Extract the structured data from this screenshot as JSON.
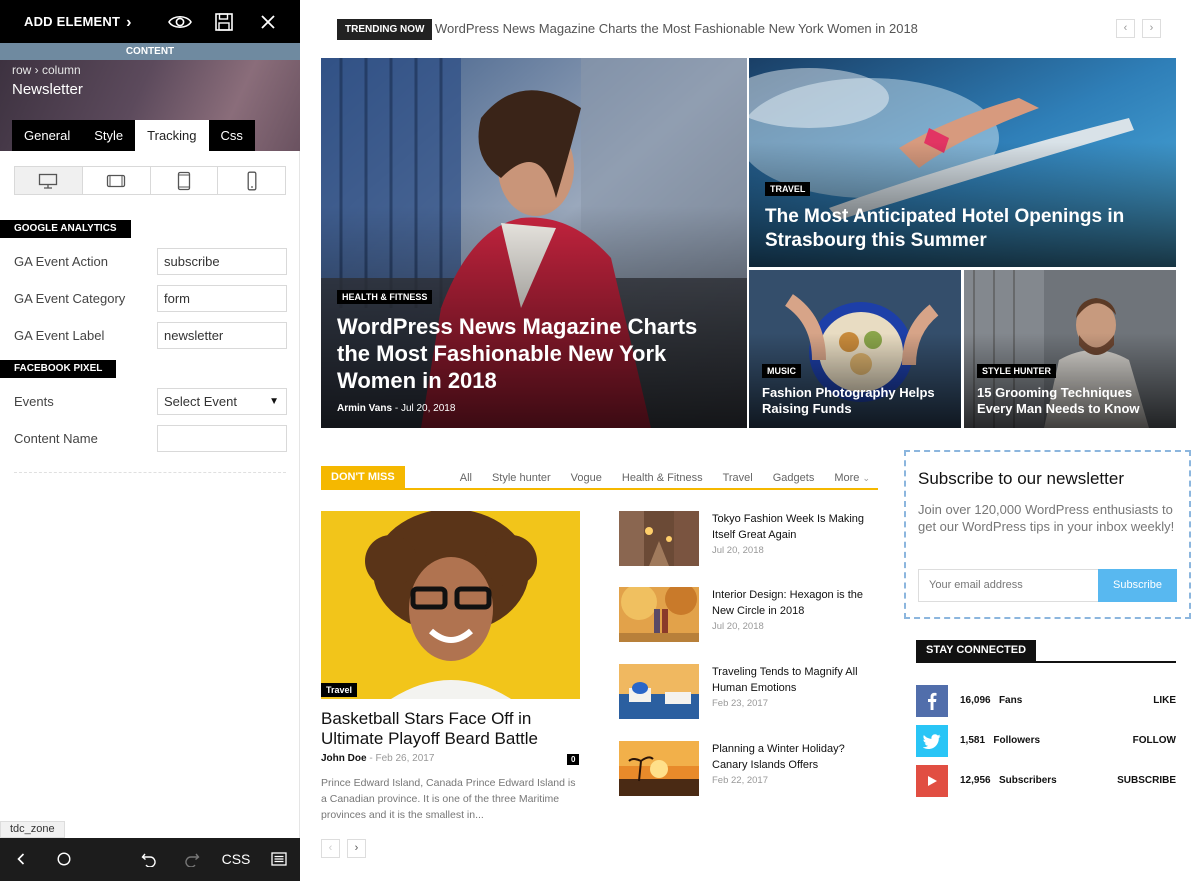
{
  "panel": {
    "add_element": "ADD ELEMENT",
    "content_strip": "CONTENT",
    "breadcrumb": "row › column",
    "element_name": "Newsletter",
    "tabs": [
      {
        "label": "General"
      },
      {
        "label": "Style"
      },
      {
        "label": "Tracking",
        "active": true
      },
      {
        "label": "Css"
      }
    ],
    "ga": {
      "heading": "GOOGLE ANALYTICS",
      "rows": [
        {
          "label": "GA Event Action",
          "value": "subscribe"
        },
        {
          "label": "GA Event Category",
          "value": "form"
        },
        {
          "label": "GA Event Label",
          "value": "newsletter"
        }
      ]
    },
    "fb": {
      "heading": "FACEBOOK PIXEL",
      "events_label": "Events",
      "events_value": "Select Event",
      "content_label": "Content Name",
      "content_value": ""
    },
    "zone_tag": "tdc_zone",
    "bottom_css": "CSS"
  },
  "preview": {
    "trending_label": "TRENDING NOW",
    "trending_text": "WordPress News Magazine Charts the Most Fashionable New York Women in 2018",
    "prev": "‹",
    "next": "›",
    "grid": {
      "main": {
        "category": "HEALTH & FITNESS",
        "title": "WordPress News Magazine Charts the Most Fashionable New York Women in 2018",
        "author": "Armin Vans",
        "date": "Jul 20, 2018"
      },
      "top_right": {
        "category": "TRAVEL",
        "title": "The Most Anticipated Hotel Openings in Strasbourg this Summer"
      },
      "bottom_left": {
        "category": "MUSIC",
        "title": "Fashion Photography Helps Raising Funds"
      },
      "bottom_right": {
        "category": "STYLE HUNTER",
        "title": "15 Grooming Techniques Every Man Needs to Know"
      }
    },
    "dont_miss": {
      "label": "DON'T MISS",
      "filters": [
        "All",
        "Style hunter",
        "Vogue",
        "Health & Fitness",
        "Travel",
        "Gadgets",
        "More"
      ],
      "featured": {
        "category": "Travel",
        "title": "Basketball Stars Face Off in Ultimate Playoff Beard Battle",
        "author": "John Doe",
        "date": "Feb 26, 2017",
        "comments": "0",
        "excerpt": "Prince Edward Island, Canada Prince Edward Island is a Canadian province. It is one of the three Maritime provinces and it is the smallest in..."
      },
      "list": [
        {
          "title": "Tokyo Fashion Week Is Making Itself Great Again",
          "date": "Jul 20, 2018"
        },
        {
          "title": "Interior Design: Hexagon is the New Circle in 2018",
          "date": "Jul 20, 2018"
        },
        {
          "title": "Traveling Tends to Magnify All Human Emotions",
          "date": "Feb 23, 2017"
        },
        {
          "title": "Planning a Winter Holiday? Canary Islands Offers",
          "date": "Feb 22, 2017"
        }
      ]
    },
    "newsletter": {
      "title": "Subscribe to our newsletter",
      "description": "Join over 120,000 WordPress enthusiasts to get our WordPress tips in your inbox weekly!",
      "placeholder": "Your email address",
      "button": "Subscribe"
    },
    "stay": {
      "label": "STAY CONNECTED",
      "items": [
        {
          "count": "16,096",
          "unit": "Fans",
          "action": "LIKE",
          "color": "#516eab",
          "icon": "facebook-icon"
        },
        {
          "count": "1,581",
          "unit": "Followers",
          "action": "FOLLOW",
          "color": "#29c5f6",
          "icon": "twitter-icon"
        },
        {
          "count": "12,956",
          "unit": "Subscribers",
          "action": "SUBSCRIBE",
          "color": "#e14e42",
          "icon": "youtube-icon"
        }
      ]
    }
  },
  "colors": {
    "accent_yellow": "#f5b800",
    "subscribe_blue": "#58b8f0",
    "content_strip": "#6f8aa0"
  }
}
